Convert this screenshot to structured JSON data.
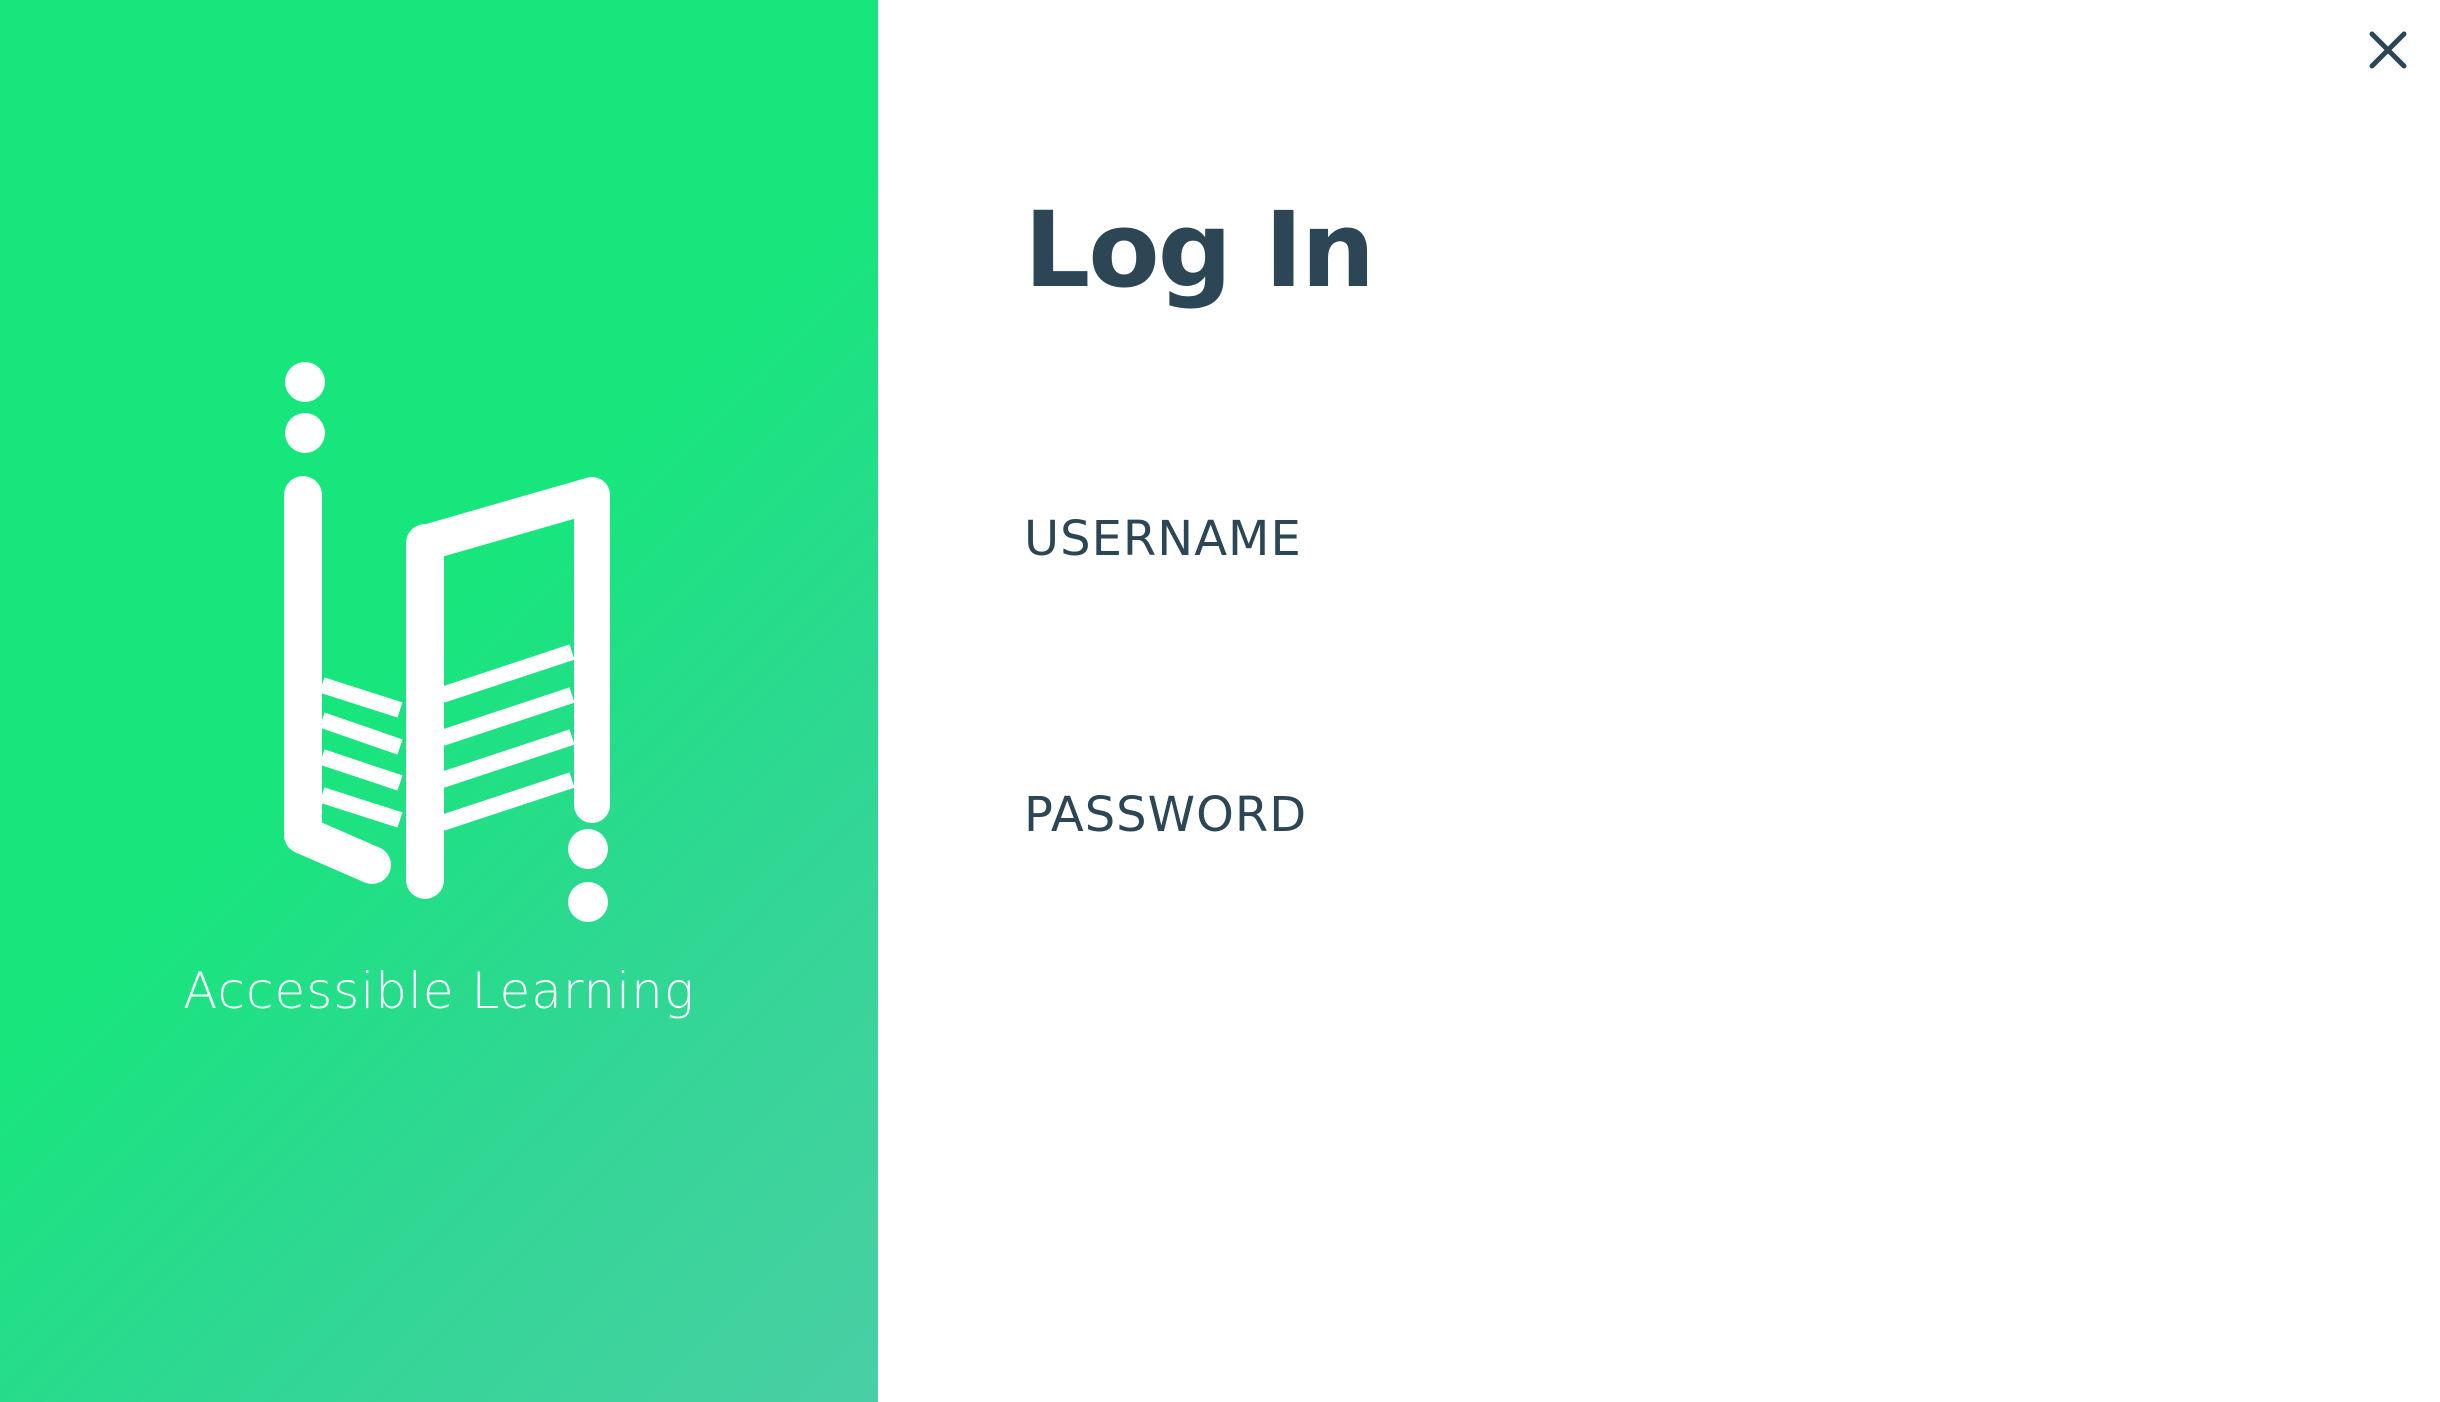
{
  "app": {
    "brand_name": "Accessible Learning",
    "icons": {
      "logo": "accessible-learning-logo-icon",
      "close": "close-icon"
    },
    "colors": {
      "brand_green": "#17e67c",
      "brand_teal": "#4acfa5",
      "text_dark": "#2c4656",
      "background": "#ffffff"
    }
  },
  "login": {
    "title": "Log In",
    "username_label": "USERNAME",
    "username_value": "",
    "password_label": "PASSWORD",
    "password_value": ""
  }
}
